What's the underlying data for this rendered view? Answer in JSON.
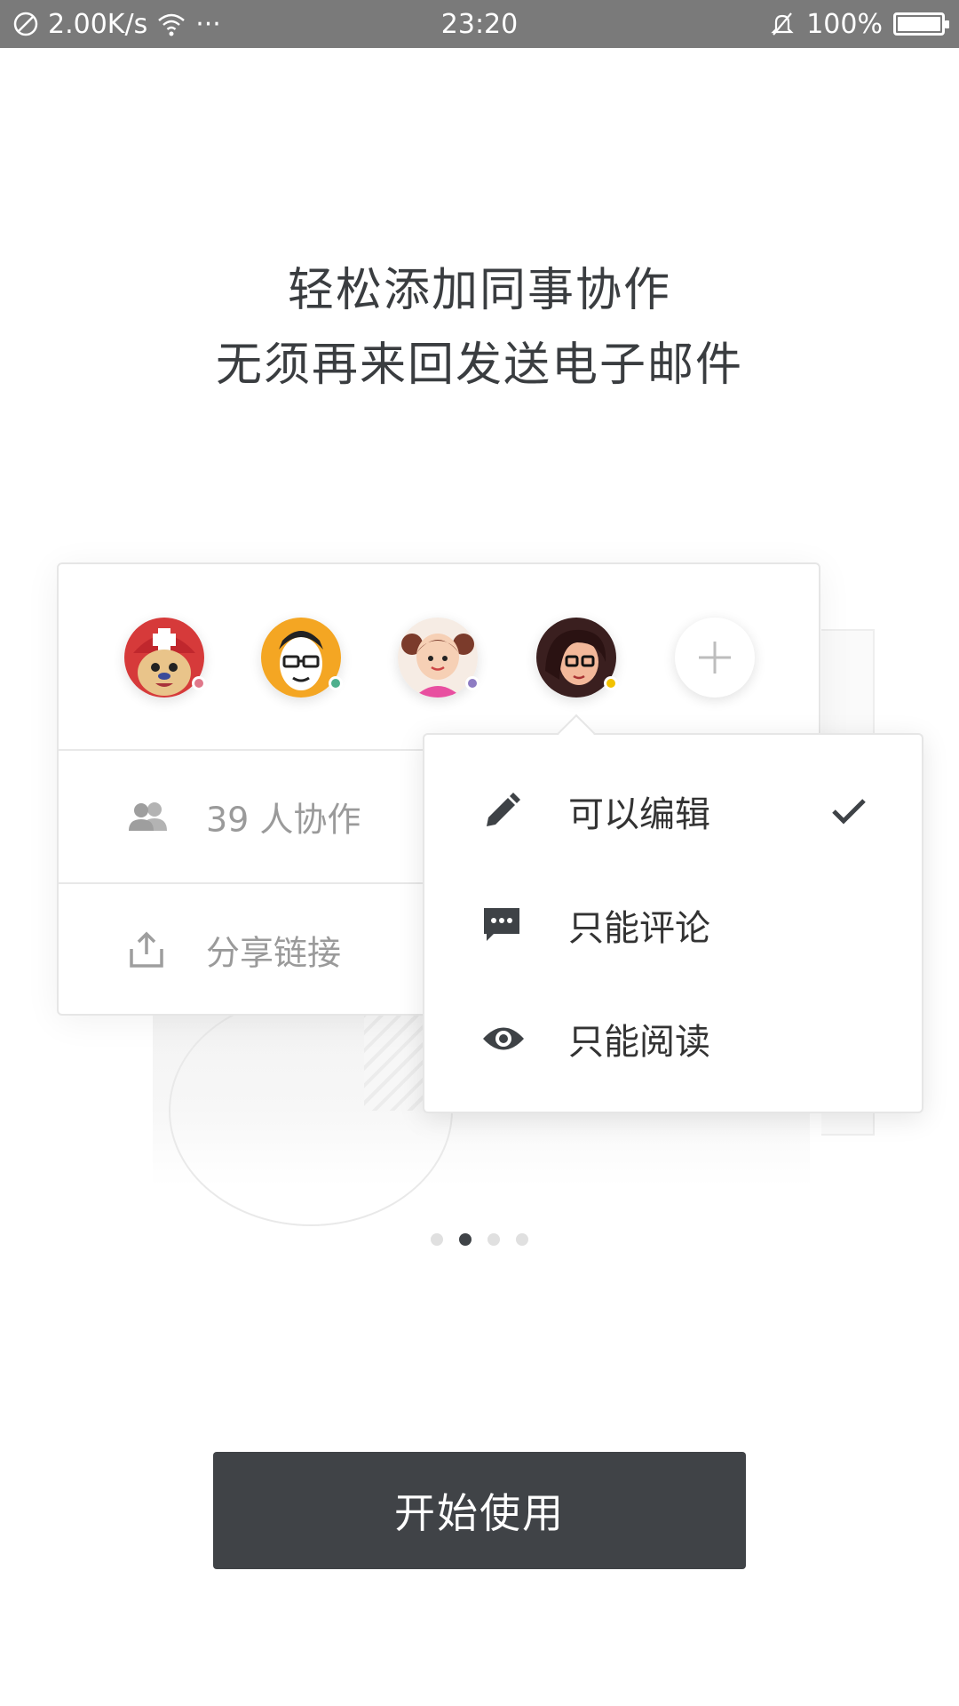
{
  "status_bar": {
    "net_speed": "2.00K/s",
    "more": "···",
    "time": "23:20",
    "battery": "100%",
    "battery_level": 1.0
  },
  "headline": {
    "line1": "轻松添加同事协作",
    "line2": "无须再来回发送电子邮件"
  },
  "card": {
    "avatars": [
      {
        "name": "avatar-chopper",
        "dot_color": "#e0788a"
      },
      {
        "name": "avatar-glasses-man",
        "dot_color": "#4fb08e"
      },
      {
        "name": "avatar-pigtails-girl",
        "dot_color": "#8e7cc3"
      },
      {
        "name": "avatar-dark-hair-glasses",
        "dot_color": "#f2c200"
      }
    ],
    "collaborators": "39 人协作",
    "share_link": "分享链接"
  },
  "permission_menu": {
    "items": [
      {
        "label": "可以编辑",
        "icon": "pencil-icon",
        "selected": true
      },
      {
        "label": "只能评论",
        "icon": "comment-icon",
        "selected": false
      },
      {
        "label": "只能阅读",
        "icon": "eye-icon",
        "selected": false
      }
    ]
  },
  "pager": {
    "total": 4,
    "current": 2
  },
  "start_button": "开始使用",
  "colors": {
    "button_bg": "#404347",
    "status_bar": "#7a7a7a",
    "headline": "#3a3d40"
  }
}
